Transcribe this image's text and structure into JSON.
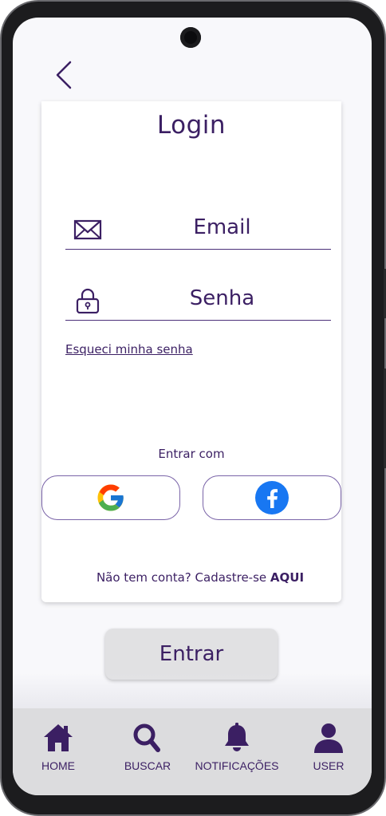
{
  "header": {
    "back_icon": "chevron-left-icon"
  },
  "login": {
    "title": "Login",
    "email": {
      "icon": "envelope-icon",
      "placeholder": "Email"
    },
    "password": {
      "icon": "lock-icon",
      "placeholder": "Senha"
    },
    "forgot_password": "Esqueci minha senha",
    "enter_with": "Entrar com",
    "social": [
      {
        "name": "google",
        "icon": "google-icon"
      },
      {
        "name": "facebook",
        "icon": "facebook-icon"
      }
    ],
    "signup_prompt": "Não tem conta? Cadastre-se",
    "signup_link": "AQUI",
    "submit_label": "Entrar"
  },
  "nav": {
    "items": [
      {
        "label": "HOME",
        "icon": "home-icon"
      },
      {
        "label": "BUSCAR",
        "icon": "search-icon"
      },
      {
        "label": "NOTIFICAÇÕES",
        "icon": "bell-icon"
      },
      {
        "label": "USER",
        "icon": "user-icon"
      }
    ]
  },
  "colors": {
    "accent": "#3b1f63",
    "nav_background": "#dcdcde",
    "button_background": "#e1e1e3",
    "facebook_blue": "#1877f2"
  }
}
